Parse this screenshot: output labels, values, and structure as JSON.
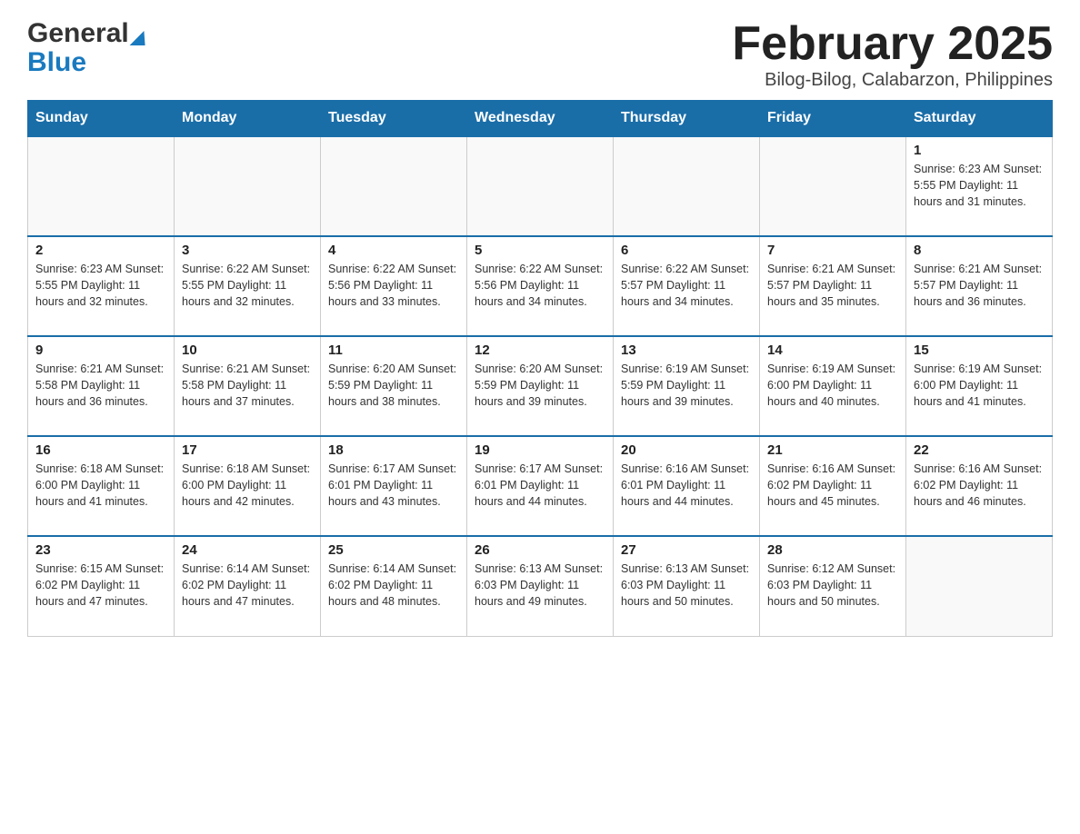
{
  "header": {
    "logo_general": "General",
    "logo_blue": "Blue",
    "month_title": "February 2025",
    "location": "Bilog-Bilog, Calabarzon, Philippines"
  },
  "weekdays": [
    "Sunday",
    "Monday",
    "Tuesday",
    "Wednesday",
    "Thursday",
    "Friday",
    "Saturday"
  ],
  "weeks": [
    [
      {
        "day": "",
        "info": ""
      },
      {
        "day": "",
        "info": ""
      },
      {
        "day": "",
        "info": ""
      },
      {
        "day": "",
        "info": ""
      },
      {
        "day": "",
        "info": ""
      },
      {
        "day": "",
        "info": ""
      },
      {
        "day": "1",
        "info": "Sunrise: 6:23 AM\nSunset: 5:55 PM\nDaylight: 11 hours and 31 minutes."
      }
    ],
    [
      {
        "day": "2",
        "info": "Sunrise: 6:23 AM\nSunset: 5:55 PM\nDaylight: 11 hours and 32 minutes."
      },
      {
        "day": "3",
        "info": "Sunrise: 6:22 AM\nSunset: 5:55 PM\nDaylight: 11 hours and 32 minutes."
      },
      {
        "day": "4",
        "info": "Sunrise: 6:22 AM\nSunset: 5:56 PM\nDaylight: 11 hours and 33 minutes."
      },
      {
        "day": "5",
        "info": "Sunrise: 6:22 AM\nSunset: 5:56 PM\nDaylight: 11 hours and 34 minutes."
      },
      {
        "day": "6",
        "info": "Sunrise: 6:22 AM\nSunset: 5:57 PM\nDaylight: 11 hours and 34 minutes."
      },
      {
        "day": "7",
        "info": "Sunrise: 6:21 AM\nSunset: 5:57 PM\nDaylight: 11 hours and 35 minutes."
      },
      {
        "day": "8",
        "info": "Sunrise: 6:21 AM\nSunset: 5:57 PM\nDaylight: 11 hours and 36 minutes."
      }
    ],
    [
      {
        "day": "9",
        "info": "Sunrise: 6:21 AM\nSunset: 5:58 PM\nDaylight: 11 hours and 36 minutes."
      },
      {
        "day": "10",
        "info": "Sunrise: 6:21 AM\nSunset: 5:58 PM\nDaylight: 11 hours and 37 minutes."
      },
      {
        "day": "11",
        "info": "Sunrise: 6:20 AM\nSunset: 5:59 PM\nDaylight: 11 hours and 38 minutes."
      },
      {
        "day": "12",
        "info": "Sunrise: 6:20 AM\nSunset: 5:59 PM\nDaylight: 11 hours and 39 minutes."
      },
      {
        "day": "13",
        "info": "Sunrise: 6:19 AM\nSunset: 5:59 PM\nDaylight: 11 hours and 39 minutes."
      },
      {
        "day": "14",
        "info": "Sunrise: 6:19 AM\nSunset: 6:00 PM\nDaylight: 11 hours and 40 minutes."
      },
      {
        "day": "15",
        "info": "Sunrise: 6:19 AM\nSunset: 6:00 PM\nDaylight: 11 hours and 41 minutes."
      }
    ],
    [
      {
        "day": "16",
        "info": "Sunrise: 6:18 AM\nSunset: 6:00 PM\nDaylight: 11 hours and 41 minutes."
      },
      {
        "day": "17",
        "info": "Sunrise: 6:18 AM\nSunset: 6:00 PM\nDaylight: 11 hours and 42 minutes."
      },
      {
        "day": "18",
        "info": "Sunrise: 6:17 AM\nSunset: 6:01 PM\nDaylight: 11 hours and 43 minutes."
      },
      {
        "day": "19",
        "info": "Sunrise: 6:17 AM\nSunset: 6:01 PM\nDaylight: 11 hours and 44 minutes."
      },
      {
        "day": "20",
        "info": "Sunrise: 6:16 AM\nSunset: 6:01 PM\nDaylight: 11 hours and 44 minutes."
      },
      {
        "day": "21",
        "info": "Sunrise: 6:16 AM\nSunset: 6:02 PM\nDaylight: 11 hours and 45 minutes."
      },
      {
        "day": "22",
        "info": "Sunrise: 6:16 AM\nSunset: 6:02 PM\nDaylight: 11 hours and 46 minutes."
      }
    ],
    [
      {
        "day": "23",
        "info": "Sunrise: 6:15 AM\nSunset: 6:02 PM\nDaylight: 11 hours and 47 minutes."
      },
      {
        "day": "24",
        "info": "Sunrise: 6:14 AM\nSunset: 6:02 PM\nDaylight: 11 hours and 47 minutes."
      },
      {
        "day": "25",
        "info": "Sunrise: 6:14 AM\nSunset: 6:02 PM\nDaylight: 11 hours and 48 minutes."
      },
      {
        "day": "26",
        "info": "Sunrise: 6:13 AM\nSunset: 6:03 PM\nDaylight: 11 hours and 49 minutes."
      },
      {
        "day": "27",
        "info": "Sunrise: 6:13 AM\nSunset: 6:03 PM\nDaylight: 11 hours and 50 minutes."
      },
      {
        "day": "28",
        "info": "Sunrise: 6:12 AM\nSunset: 6:03 PM\nDaylight: 11 hours and 50 minutes."
      },
      {
        "day": "",
        "info": ""
      }
    ]
  ]
}
